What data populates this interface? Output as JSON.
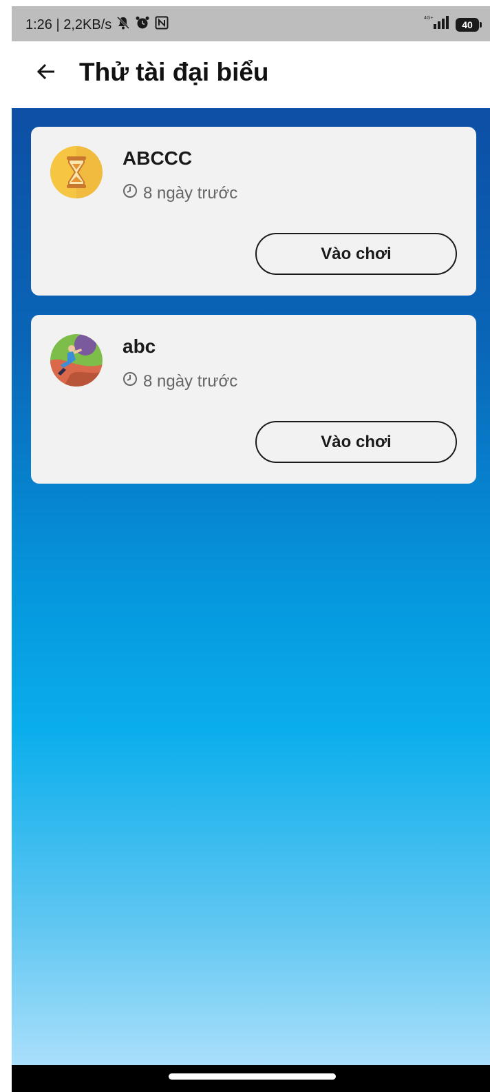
{
  "status_bar": {
    "time_speed": "1:26 | 2,2KB/s",
    "icons": [
      "mute-bell-icon",
      "alarm-icon",
      "nfc-icon"
    ],
    "network": "4G+",
    "battery": "40"
  },
  "header": {
    "back_icon": "arrow-left-icon",
    "title": "Thử tài đại biểu"
  },
  "games": [
    {
      "name": "ABCCC",
      "avatar": "hourglass-icon",
      "time": "8 ngày trước",
      "button_label": "Vào chơi"
    },
    {
      "name": "abc",
      "avatar": "climber-icon",
      "time": "8 ngày trước",
      "button_label": "Vào chơi"
    }
  ],
  "colors": {
    "gradient_top": "#0d4fa5",
    "gradient_bottom": "#a9dffb",
    "card_bg": "#f2f2f2"
  }
}
